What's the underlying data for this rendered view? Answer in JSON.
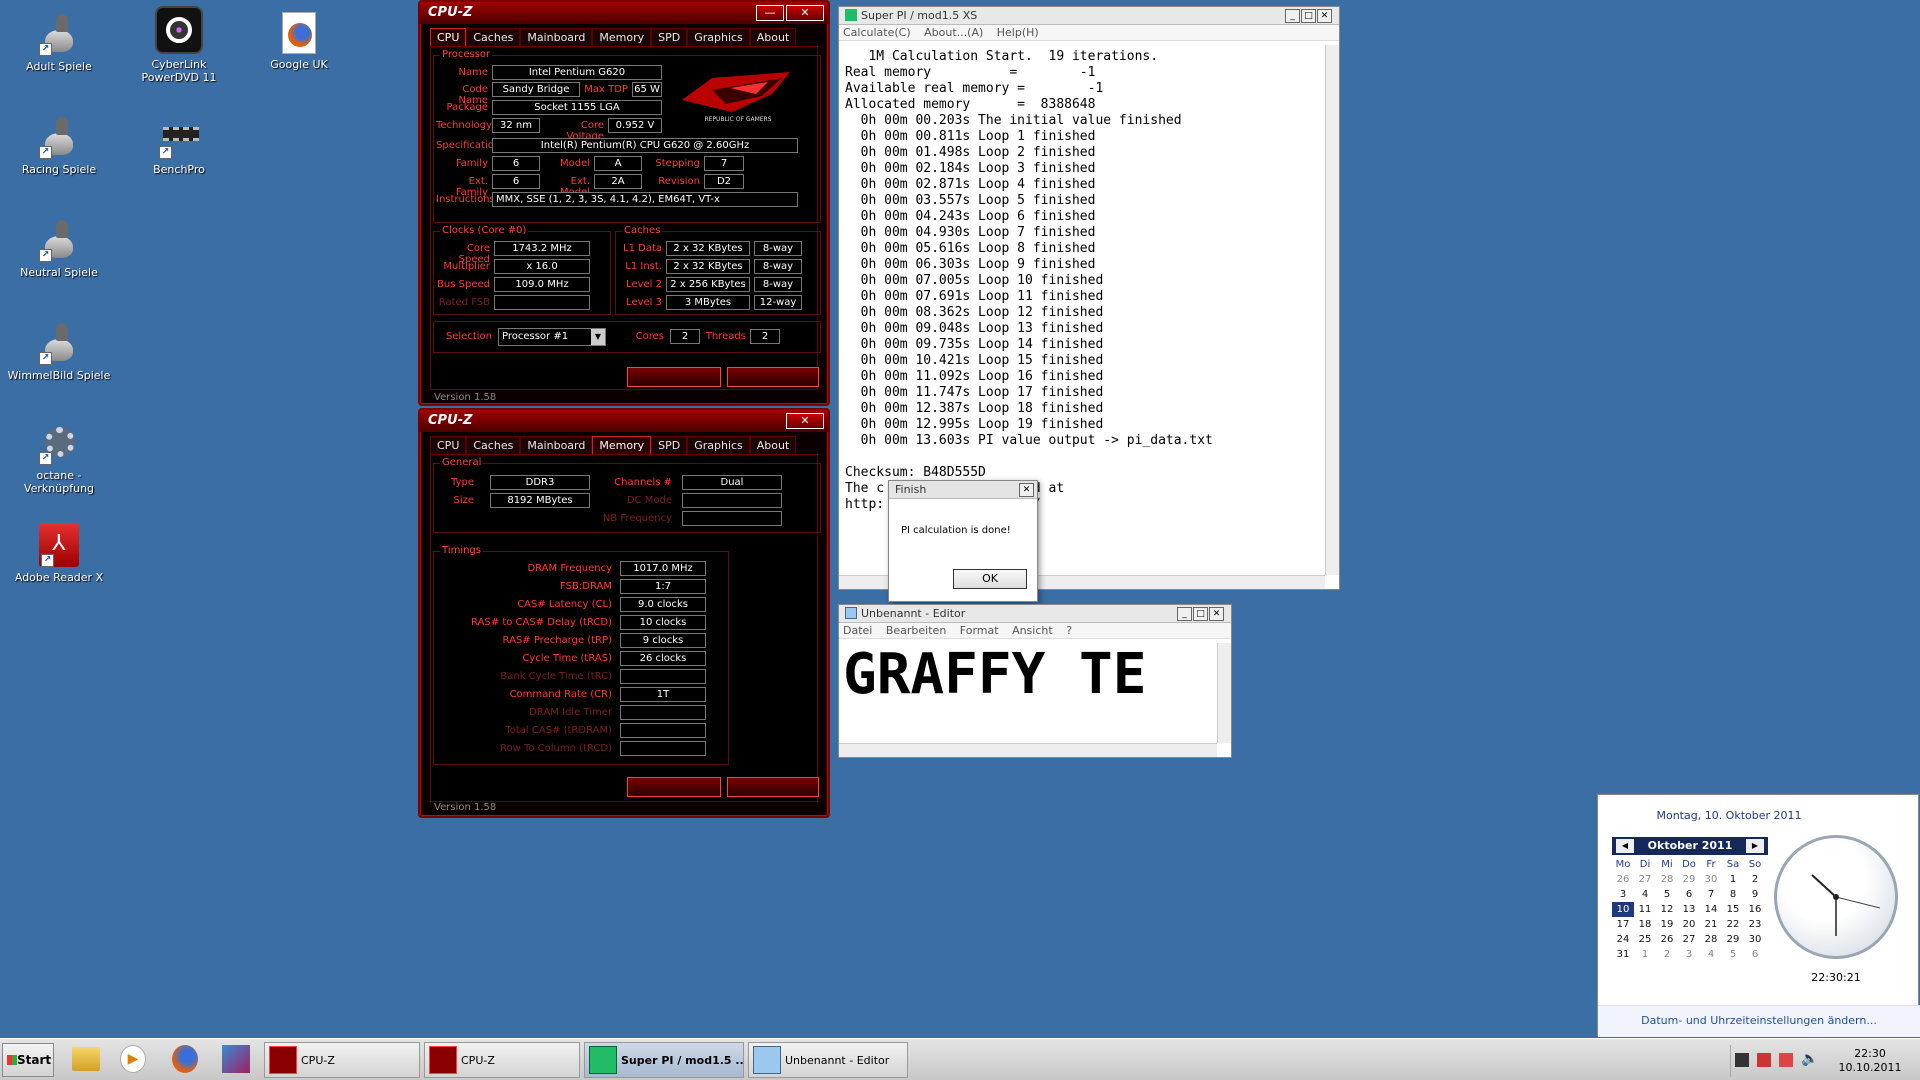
{
  "desktop_icons": [
    {
      "label": "Adult Spiele"
    },
    {
      "label": "CyberLink PowerDVD 11"
    },
    {
      "label": "Google UK"
    },
    {
      "label": "Racing Spiele"
    },
    {
      "label": "BenchPro"
    },
    {
      "label": "Neutral Spiele"
    },
    {
      "label": "WimmelBild Spiele"
    },
    {
      "label": "octane - Verknüpfung"
    },
    {
      "label": "Adobe Reader X"
    }
  ],
  "cpuz1": {
    "title": "CPU-Z",
    "tabs": [
      "CPU",
      "Caches",
      "Mainboard",
      "Memory",
      "SPD",
      "Graphics",
      "About"
    ],
    "active_tab": "CPU",
    "processor_group": "Processor",
    "labels": {
      "name": "Name",
      "codename": "Code Name",
      "maxtdp": "Max TDP",
      "package": "Package",
      "technology": "Technology",
      "corevoltage": "Core Voltage",
      "specification": "Specification",
      "family": "Family",
      "model": "Model",
      "stepping": "Stepping",
      "extfamily": "Ext. Family",
      "extmodel": "Ext. Model",
      "revision": "Revision",
      "instructions": "Instructions",
      "corespeed": "Core Speed",
      "multiplier": "Multiplier",
      "busspeed": "Bus Speed",
      "ratedfsb": "Rated FSB",
      "l1data": "L1 Data",
      "l1inst": "L1 Inst.",
      "level2": "Level 2",
      "level3": "Level 3",
      "selection": "Selection",
      "cores": "Cores",
      "threads": "Threads"
    },
    "name": "Intel Pentium G620",
    "codename": "Sandy Bridge",
    "maxtdp": "65 W",
    "package": "Socket 1155 LGA",
    "technology": "32 nm",
    "corevoltage": "0.952 V",
    "specification": "Intel(R) Pentium(R) CPU G620 @ 2.60GHz",
    "family": "6",
    "model": "A",
    "stepping": "7",
    "extfamily": "6",
    "extmodel": "2A",
    "revision": "D2",
    "instructions": "MMX, SSE (1, 2, 3, 3S, 4.1, 4.2), EM64T, VT-x",
    "clocks_group": "Clocks (Core #0)",
    "corespeed": "1743.2 MHz",
    "multiplier": "x 16.0",
    "busspeed": "109.0 MHz",
    "caches_group": "Caches",
    "l1data": "2 x 32 KBytes",
    "l1data_way": "8-way",
    "l1inst": "2 x 32 KBytes",
    "l1inst_way": "8-way",
    "level2": "2 x 256 KBytes",
    "level2_way": "8-way",
    "level3": "3 MBytes",
    "level3_way": "12-way",
    "selection": "Processor #1",
    "cores": "2",
    "threads": "2",
    "version": "Version 1.58",
    "logo_text": "REPUBLIC OF GAMERS"
  },
  "cpuz2": {
    "title": "CPU-Z",
    "tabs": [
      "CPU",
      "Caches",
      "Mainboard",
      "Memory",
      "SPD",
      "Graphics",
      "About"
    ],
    "active_tab": "Memory",
    "general_group": "General",
    "labels": {
      "type": "Type",
      "size": "Size",
      "channels": "Channels #",
      "dcmode": "DC Mode",
      "nbfreq": "NB Frequency",
      "dramfreq": "DRAM Frequency",
      "fsbdram": "FSB:DRAM",
      "cl": "CAS# Latency (CL)",
      "trcd": "RAS# to CAS# Delay (tRCD)",
      "trp": "RAS# Precharge (tRP)",
      "tras": "Cycle Time (tRAS)",
      "trc": "Bank Cycle Time (tRC)",
      "cr": "Command Rate (CR)",
      "idle": "DRAM Idle Timer",
      "trdram": "Total CAS# (tRDRAM)",
      "rowcol": "Row To Column (tRCD)"
    },
    "type": "DDR3",
    "size": "8192 MBytes",
    "channels": "Dual",
    "timings_group": "Timings",
    "dramfreq": "1017.0 MHz",
    "fsbdram": "1:7",
    "cl": "9.0 clocks",
    "trcd": "10 clocks",
    "trp": "9 clocks",
    "tras": "26 clocks",
    "cr": "1T",
    "version": "Version 1.58"
  },
  "superpi": {
    "title": "Super PI / mod1.5 XS",
    "menu": [
      "Calculate(C)",
      "About...(A)",
      "Help(H)"
    ],
    "lines": [
      "   1M Calculation Start.  19 iterations.",
      "Real memory          =        -1",
      "Available real memory =        -1",
      "Allocated memory      =  8388648",
      "  0h 00m 00.203s The initial value finished",
      "  0h 00m 00.811s Loop 1 finished",
      "  0h 00m 01.498s Loop 2 finished",
      "  0h 00m 02.184s Loop 3 finished",
      "  0h 00m 02.871s Loop 4 finished",
      "  0h 00m 03.557s Loop 5 finished",
      "  0h 00m 04.243s Loop 6 finished",
      "  0h 00m 04.930s Loop 7 finished",
      "  0h 00m 05.616s Loop 8 finished",
      "  0h 00m 06.303s Loop 9 finished",
      "  0h 00m 07.005s Loop 10 finished",
      "  0h 00m 07.691s Loop 11 finished",
      "  0h 00m 08.362s Loop 12 finished",
      "  0h 00m 09.048s Loop 13 finished",
      "  0h 00m 09.735s Loop 14 finished",
      "  0h 00m 10.421s Loop 15 finished",
      "  0h 00m 11.092s Loop 16 finished",
      "  0h 00m 11.747s Loop 17 finished",
      "  0h 00m 12.387s Loop 18 finished",
      "  0h 00m 12.995s Loop 19 finished",
      "  0h 00m 13.603s PI value output -> pi_data.txt",
      "",
      "Checksum: B48D555D",
      "The c            alidated at",
      "http:            ems.org/"
    ]
  },
  "finish_dialog": {
    "title": "Finish",
    "message": "PI calculation is done!",
    "ok": "OK"
  },
  "editor": {
    "title": "Unbenannt - Editor",
    "menu": [
      "Datei",
      "Bearbeiten",
      "Format",
      "Ansicht",
      "?"
    ],
    "content": "GRAFFY TE"
  },
  "calendar": {
    "date_header": "Montag, 10. Oktober 2011",
    "month": "Oktober 2011",
    "weekdays": [
      "Mo",
      "Di",
      "Mi",
      "Do",
      "Fr",
      "Sa",
      "So"
    ],
    "weeks": [
      [
        "26",
        "27",
        "28",
        "29",
        "30",
        "1",
        "2"
      ],
      [
        "3",
        "4",
        "5",
        "6",
        "7",
        "8",
        "9"
      ],
      [
        "10",
        "11",
        "12",
        "13",
        "14",
        "15",
        "16"
      ],
      [
        "17",
        "18",
        "19",
        "20",
        "21",
        "22",
        "23"
      ],
      [
        "24",
        "25",
        "26",
        "27",
        "28",
        "29",
        "30"
      ],
      [
        "31",
        "1",
        "2",
        "3",
        "4",
        "5",
        "6"
      ]
    ],
    "time": "22:30:21",
    "settings_link": "Datum- und Uhrzeiteinstellungen ändern..."
  },
  "taskbar": {
    "start": "Start",
    "items": [
      "CPU-Z",
      "CPU-Z",
      "Super PI / mod1.5 ...",
      "Unbenannt - Editor"
    ],
    "clock_time": "22:30",
    "clock_date": "10.10.2011"
  }
}
